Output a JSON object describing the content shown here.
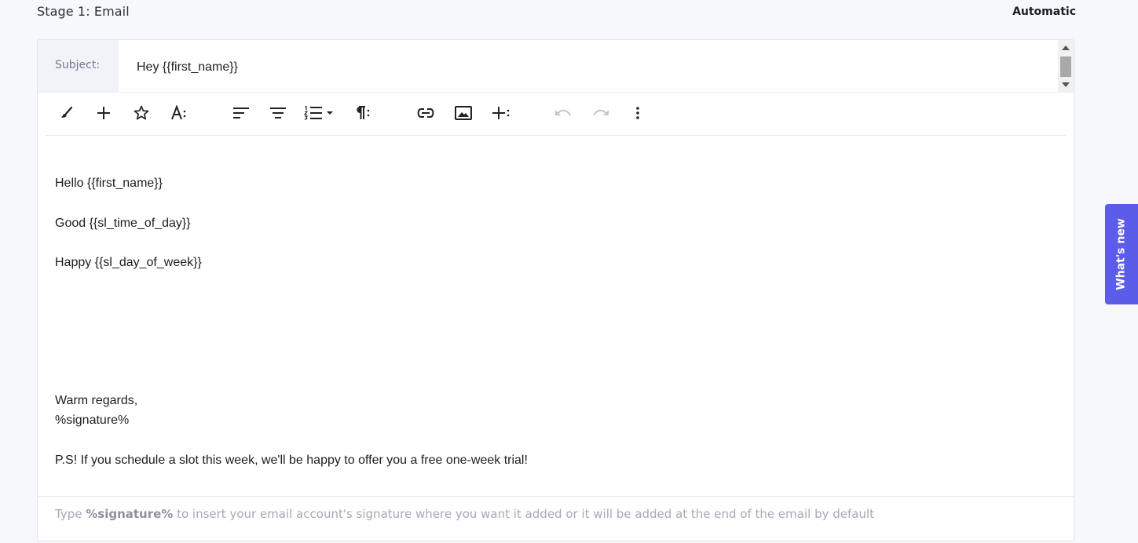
{
  "stage": {
    "title": "Stage 1: Email",
    "mode": "Automatic"
  },
  "subject": {
    "label": "Subject:",
    "value": "Hey {{first_name}}"
  },
  "toolbar": {
    "buttons": [
      "paintbrush-icon",
      "plus-icon",
      "star-icon",
      "text-format-icon",
      "align-left-icon",
      "align-center-icon",
      "ordered-list-icon",
      "paragraph-icon",
      "link-icon",
      "image-icon",
      "insert-more-icon",
      "undo-icon",
      "redo-icon",
      "more-icon"
    ]
  },
  "body": {
    "lines": [
      "Hello {{first_name}}",
      "Good {{sl_time_of_day}}",
      "Happy {{sl_day_of_week}}",
      "Warm regards,",
      "%signature%",
      "P.S! If you schedule a slot this week, we'll be happy to offer you a free one-week trial!"
    ]
  },
  "hint": {
    "prefix": "Type ",
    "token": "%signature%",
    "suffix": " to insert your email account's signature where you want it added or it will be added at the end of the email by default"
  },
  "side_tab": {
    "label": "What's new"
  },
  "colors": {
    "accent": "#5b5ce8",
    "background": "#f7f8fb",
    "subject_label_bg": "#f1f3f9"
  }
}
